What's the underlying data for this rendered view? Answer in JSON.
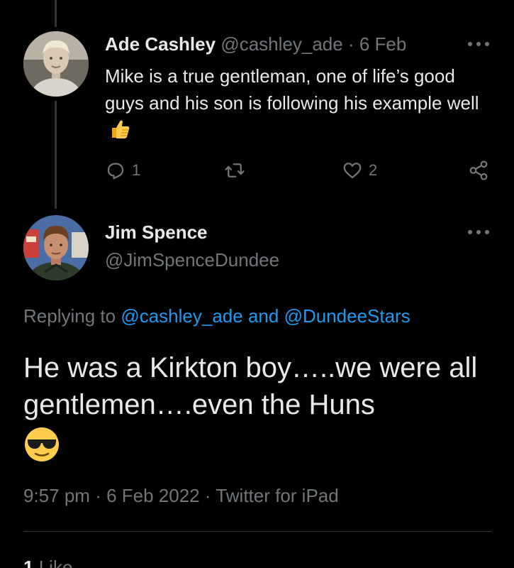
{
  "reply_tweet": {
    "author_name": "Ade Cashley",
    "handle": "@cashley_ade",
    "separator": "·",
    "date": "6 Feb",
    "text": "Mike is a true gentleman, one of life’s good guys and his son is following his example well",
    "emoji": "thumbs-up",
    "actions": {
      "reply_count": "1",
      "retweet_count": "",
      "like_count": "2"
    }
  },
  "main_tweet": {
    "author_name": "Jim Spence",
    "handle": "@JimSpenceDundee",
    "replying_prefix": "Replying to",
    "replying_user_1": "@cashley_ade",
    "replying_and": "and",
    "replying_user_2": "@DundeeStars",
    "text": "He was a Kirkton boy…..we were all gentlemen….even the Huns",
    "emoji": "smiling-face-with-sunglasses",
    "time": "9:57 pm",
    "separator_1": "·",
    "date": "6 Feb 2022",
    "separator_2": "·",
    "source": "Twitter for iPad",
    "likes_count": "1",
    "likes_label": "Like"
  },
  "colors": {
    "background": "#000000",
    "text": "#e7e9ea",
    "muted": "#71767b",
    "link": "#1d9bf0",
    "divider": "#2f3336"
  }
}
